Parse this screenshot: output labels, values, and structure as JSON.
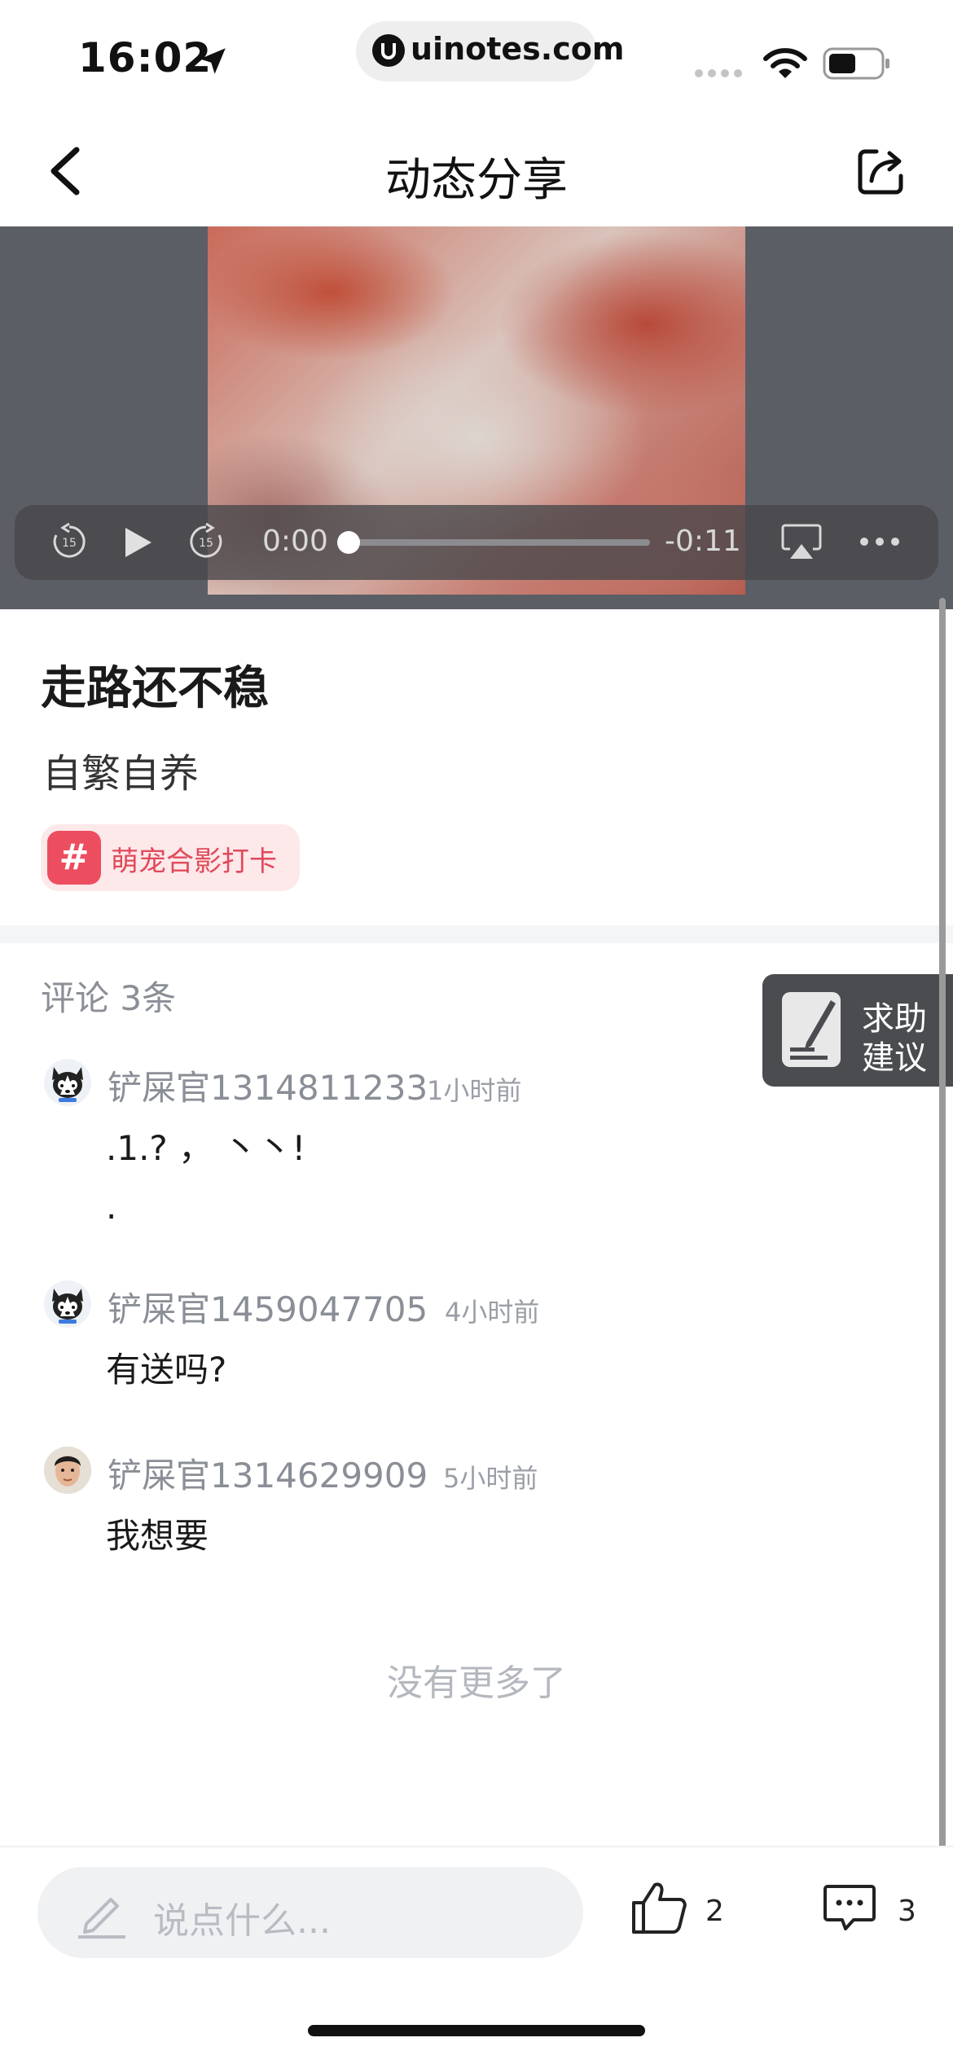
{
  "status_bar": {
    "time": "16:02",
    "url": "uinotes.com",
    "url_icon": "u-logo-icon"
  },
  "nav": {
    "title": "动态分享",
    "back_icon": "back-chevron-icon",
    "share_icon": "share-icon"
  },
  "video": {
    "elapsed": "0:00",
    "remaining": "-0:11",
    "progress": 0.0,
    "controls": [
      "rewind-15-icon",
      "play-icon",
      "forward-15-icon",
      "airplay-icon",
      "more-icon"
    ]
  },
  "post": {
    "title": "走路还不稳",
    "subtitle": "自繁自养",
    "tag_symbol": "#",
    "tag": "萌宠合影打卡"
  },
  "comments": {
    "header": "评论 3条",
    "items": [
      {
        "user": "铲屎官1314811233",
        "time": "1小时前",
        "line1": ".1.? ， 丶丶!",
        "line2": ".",
        "avatar": "husky-avatar-icon"
      },
      {
        "user": "铲屎官1459047705",
        "time": "4小时前",
        "line1": "有送吗?",
        "avatar": "husky-avatar-icon"
      },
      {
        "user": "铲屎官1314629909",
        "time": "5小时前",
        "line1": "我想要",
        "avatar": "person-photo-avatar"
      }
    ],
    "end_text": "没有更多了"
  },
  "help_float": {
    "line1": "求助",
    "line2": "建议"
  },
  "bottom_bar": {
    "placeholder": "说点什么...",
    "likes": "2",
    "comment_count": "3"
  }
}
